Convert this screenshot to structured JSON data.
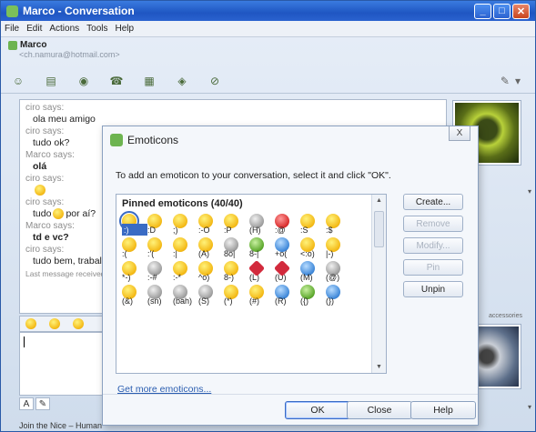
{
  "window": {
    "title": "Marco - Conversation",
    "menu": [
      "File",
      "Edit",
      "Actions",
      "Tools",
      "Help"
    ],
    "contact_name": "Marco",
    "contact_email": "<ch.namura@hotmail.com>"
  },
  "history": {
    "messages": [
      {
        "sender": "ciro says:",
        "text": "ola meu amigo",
        "bold": false,
        "emoticon": false
      },
      {
        "sender": "ciro says:",
        "text": "tudo ok?",
        "bold": false,
        "emoticon": false
      },
      {
        "sender": "Marco says:",
        "text": "olá",
        "bold": true,
        "emoticon": false
      },
      {
        "sender": "ciro says:",
        "text": "",
        "bold": false,
        "emoticon": true
      },
      {
        "sender": "ciro says:",
        "text": "tudo",
        "text_after": "por aí?",
        "bold": false,
        "emoticon": true
      },
      {
        "sender": "Marco says:",
        "text": "td e vc?",
        "bold": true,
        "emoticon": false
      },
      {
        "sender": "ciro says:",
        "text": "tudo bem, traball",
        "bold": false,
        "emoticon": false
      }
    ],
    "last_message": "Last message received at"
  },
  "side_panel": {
    "label": "accessories"
  },
  "format_bar": {
    "font_button": "A"
  },
  "ad_text": "Join the Nice – Human",
  "dialog": {
    "title": "Emoticons",
    "close_label": "X",
    "instruction": "To add an emoticon to your conversation, select it and click \"OK\".",
    "grid_header": "Pinned emoticons (40/40)",
    "rows": [
      {
        "type": "icons",
        "colors": [
          "yellow",
          "yellow",
          "yellow",
          "yellow",
          "yellow",
          "gray",
          "red",
          "yellow",
          "yellow"
        ]
      },
      {
        "type": "codes",
        "codes": [
          ":)",
          ":D",
          ";)",
          ":-O",
          ":P",
          "(H)",
          ":@",
          ":S",
          ":$"
        ]
      },
      {
        "type": "icons",
        "colors": [
          "yellow",
          "yellow",
          "yellow",
          "yellow",
          "gray",
          "green",
          "blue",
          "yellow",
          "yellow"
        ]
      },
      {
        "type": "codes",
        "codes": [
          ":(",
          ":'(",
          ":|",
          "(A)",
          "8o|",
          "8-|",
          "+o(",
          "<:o)",
          "|-)"
        ]
      },
      {
        "type": "icons",
        "colors": [
          "yellow",
          "gray",
          "yellow",
          "yellow",
          "yellow",
          "heart",
          "heart",
          "blue",
          "gray"
        ]
      },
      {
        "type": "codes",
        "codes": [
          "*-)",
          ":-#",
          ":-*",
          "^o)",
          "8-)",
          "(L)",
          "(U)",
          "(M)",
          "(@)"
        ]
      },
      {
        "type": "icons",
        "colors": [
          "yellow",
          "gray",
          "gray",
          "gray",
          "yellow",
          "yellow",
          "blue",
          "green",
          "blue"
        ]
      },
      {
        "type": "codes",
        "codes": [
          "(&)",
          "(sn)",
          "(bah)",
          "(S)",
          "(*)",
          "(#)",
          "(R)",
          "({)",
          "(})"
        ]
      }
    ],
    "side_buttons": [
      {
        "label": "Create...",
        "disabled": false
      },
      {
        "label": "Remove",
        "disabled": true
      },
      {
        "label": "Modify...",
        "disabled": true
      },
      {
        "label": "Pin",
        "disabled": true
      },
      {
        "label": "Unpin",
        "disabled": false
      }
    ],
    "more_link": "Get more emoticons...",
    "ok_label": "OK",
    "close_button_label": "Close",
    "help_label": "Help"
  }
}
